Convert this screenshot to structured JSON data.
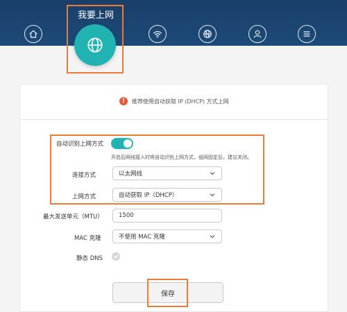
{
  "nav": {
    "active_title": "我要上网",
    "items": [
      "home-icon",
      "globe-icon",
      "wifi-icon",
      "network-icon",
      "user-icon",
      "menu-icon"
    ]
  },
  "warning": {
    "text": "推荐使用自动获取 IP (DHCP) 方式上网"
  },
  "form": {
    "auto_detect_label": "自动识别上网方式",
    "auto_detect_on": true,
    "auto_detect_hint": "开启后网线接入时将自动识别上网方式，组网固定后，建议关闭。",
    "connection_label": "连接方式",
    "connection_value": "以太网线",
    "wan_label": "上网方式",
    "wan_value": "自动获取 IP（DHCP）",
    "mtu_label": "最大发送单元（MTU）",
    "mtu_value": "1500",
    "mac_label": "MAC 克隆",
    "mac_value": "不使用 MAC 克隆",
    "dns_label": "静态 DNS",
    "save_label": "保存"
  },
  "colors": {
    "topbar": "#1a3f69",
    "accent": "#21b3b2",
    "highlight": "#ee7a35",
    "warning": "#e85a3b"
  }
}
